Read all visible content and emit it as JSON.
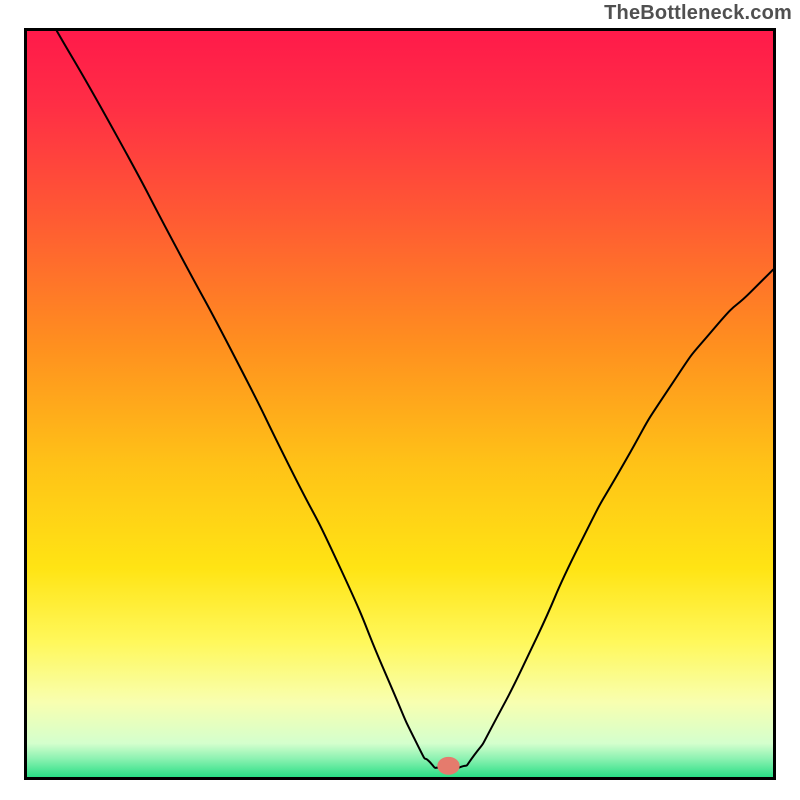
{
  "source_label": "TheBottleneck.com",
  "chart_data": {
    "type": "line",
    "title": "",
    "xlabel": "",
    "ylabel": "",
    "xlim": [
      0,
      100
    ],
    "ylim": [
      0,
      100
    ],
    "legend": null,
    "annotations": [],
    "gradient_stops": [
      {
        "offset": 0.0,
        "color": "#ff1a4a"
      },
      {
        "offset": 0.1,
        "color": "#ff2e45"
      },
      {
        "offset": 0.25,
        "color": "#ff5a33"
      },
      {
        "offset": 0.42,
        "color": "#ff8f1f"
      },
      {
        "offset": 0.58,
        "color": "#ffc217"
      },
      {
        "offset": 0.72,
        "color": "#ffe414"
      },
      {
        "offset": 0.82,
        "color": "#fff85c"
      },
      {
        "offset": 0.9,
        "color": "#f8ffb0"
      },
      {
        "offset": 0.955,
        "color": "#d4ffcd"
      },
      {
        "offset": 0.975,
        "color": "#8ef2b2"
      },
      {
        "offset": 1.0,
        "color": "#2adf86"
      }
    ],
    "min_region": {
      "x": 56.5,
      "y": 1.5,
      "rx": 1.5,
      "ry": 1.2,
      "color": "#e57b6d"
    },
    "curve_points": [
      [
        4,
        100
      ],
      [
        12,
        86
      ],
      [
        20,
        71
      ],
      [
        28,
        56
      ],
      [
        35,
        42
      ],
      [
        42,
        28
      ],
      [
        48,
        14
      ],
      [
        52,
        5
      ],
      [
        54,
        2
      ],
      [
        55.5,
        1.2
      ],
      [
        58,
        1.3
      ],
      [
        60,
        3
      ],
      [
        63,
        8
      ],
      [
        68,
        18
      ],
      [
        74,
        31
      ],
      [
        80,
        42
      ],
      [
        86,
        52
      ],
      [
        92,
        60
      ],
      [
        97,
        65
      ],
      [
        100,
        68
      ]
    ]
  }
}
